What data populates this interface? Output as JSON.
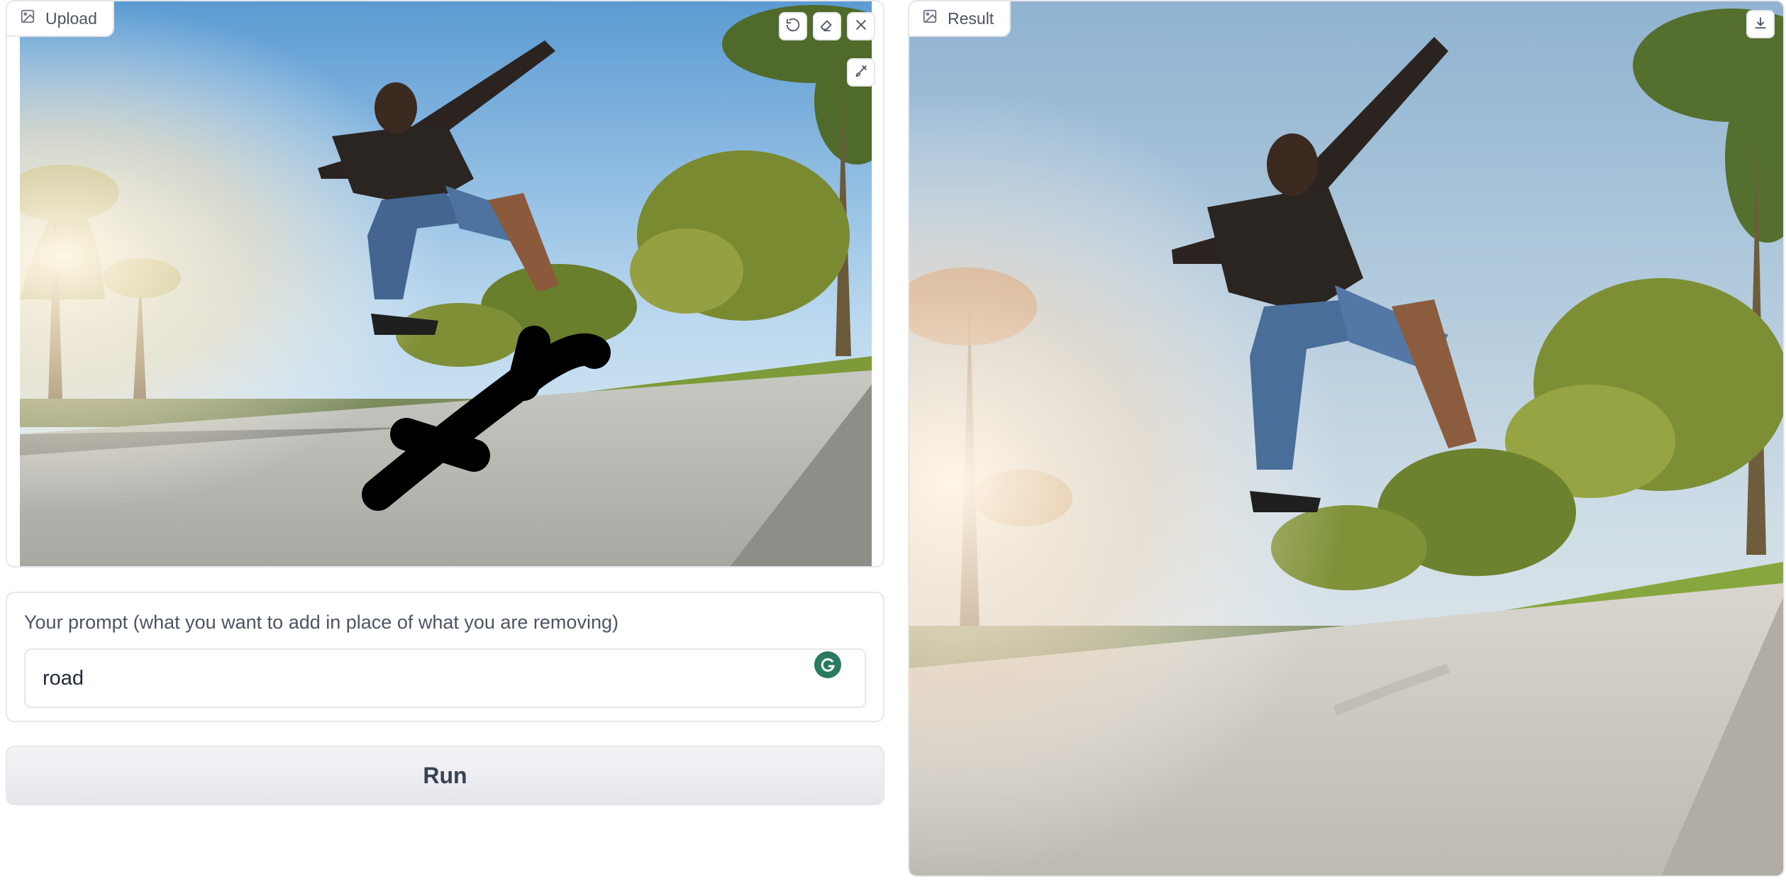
{
  "upload": {
    "label": "Upload",
    "icons": [
      "image-icon",
      "undo-icon",
      "eraser-icon",
      "close-icon",
      "brush-icon"
    ]
  },
  "prompt": {
    "label": "Your prompt (what you want to add in place of what you are removing)",
    "value": "road"
  },
  "run": {
    "label": "Run"
  },
  "result": {
    "label": "Result",
    "icons": [
      "image-icon",
      "download-icon"
    ]
  }
}
